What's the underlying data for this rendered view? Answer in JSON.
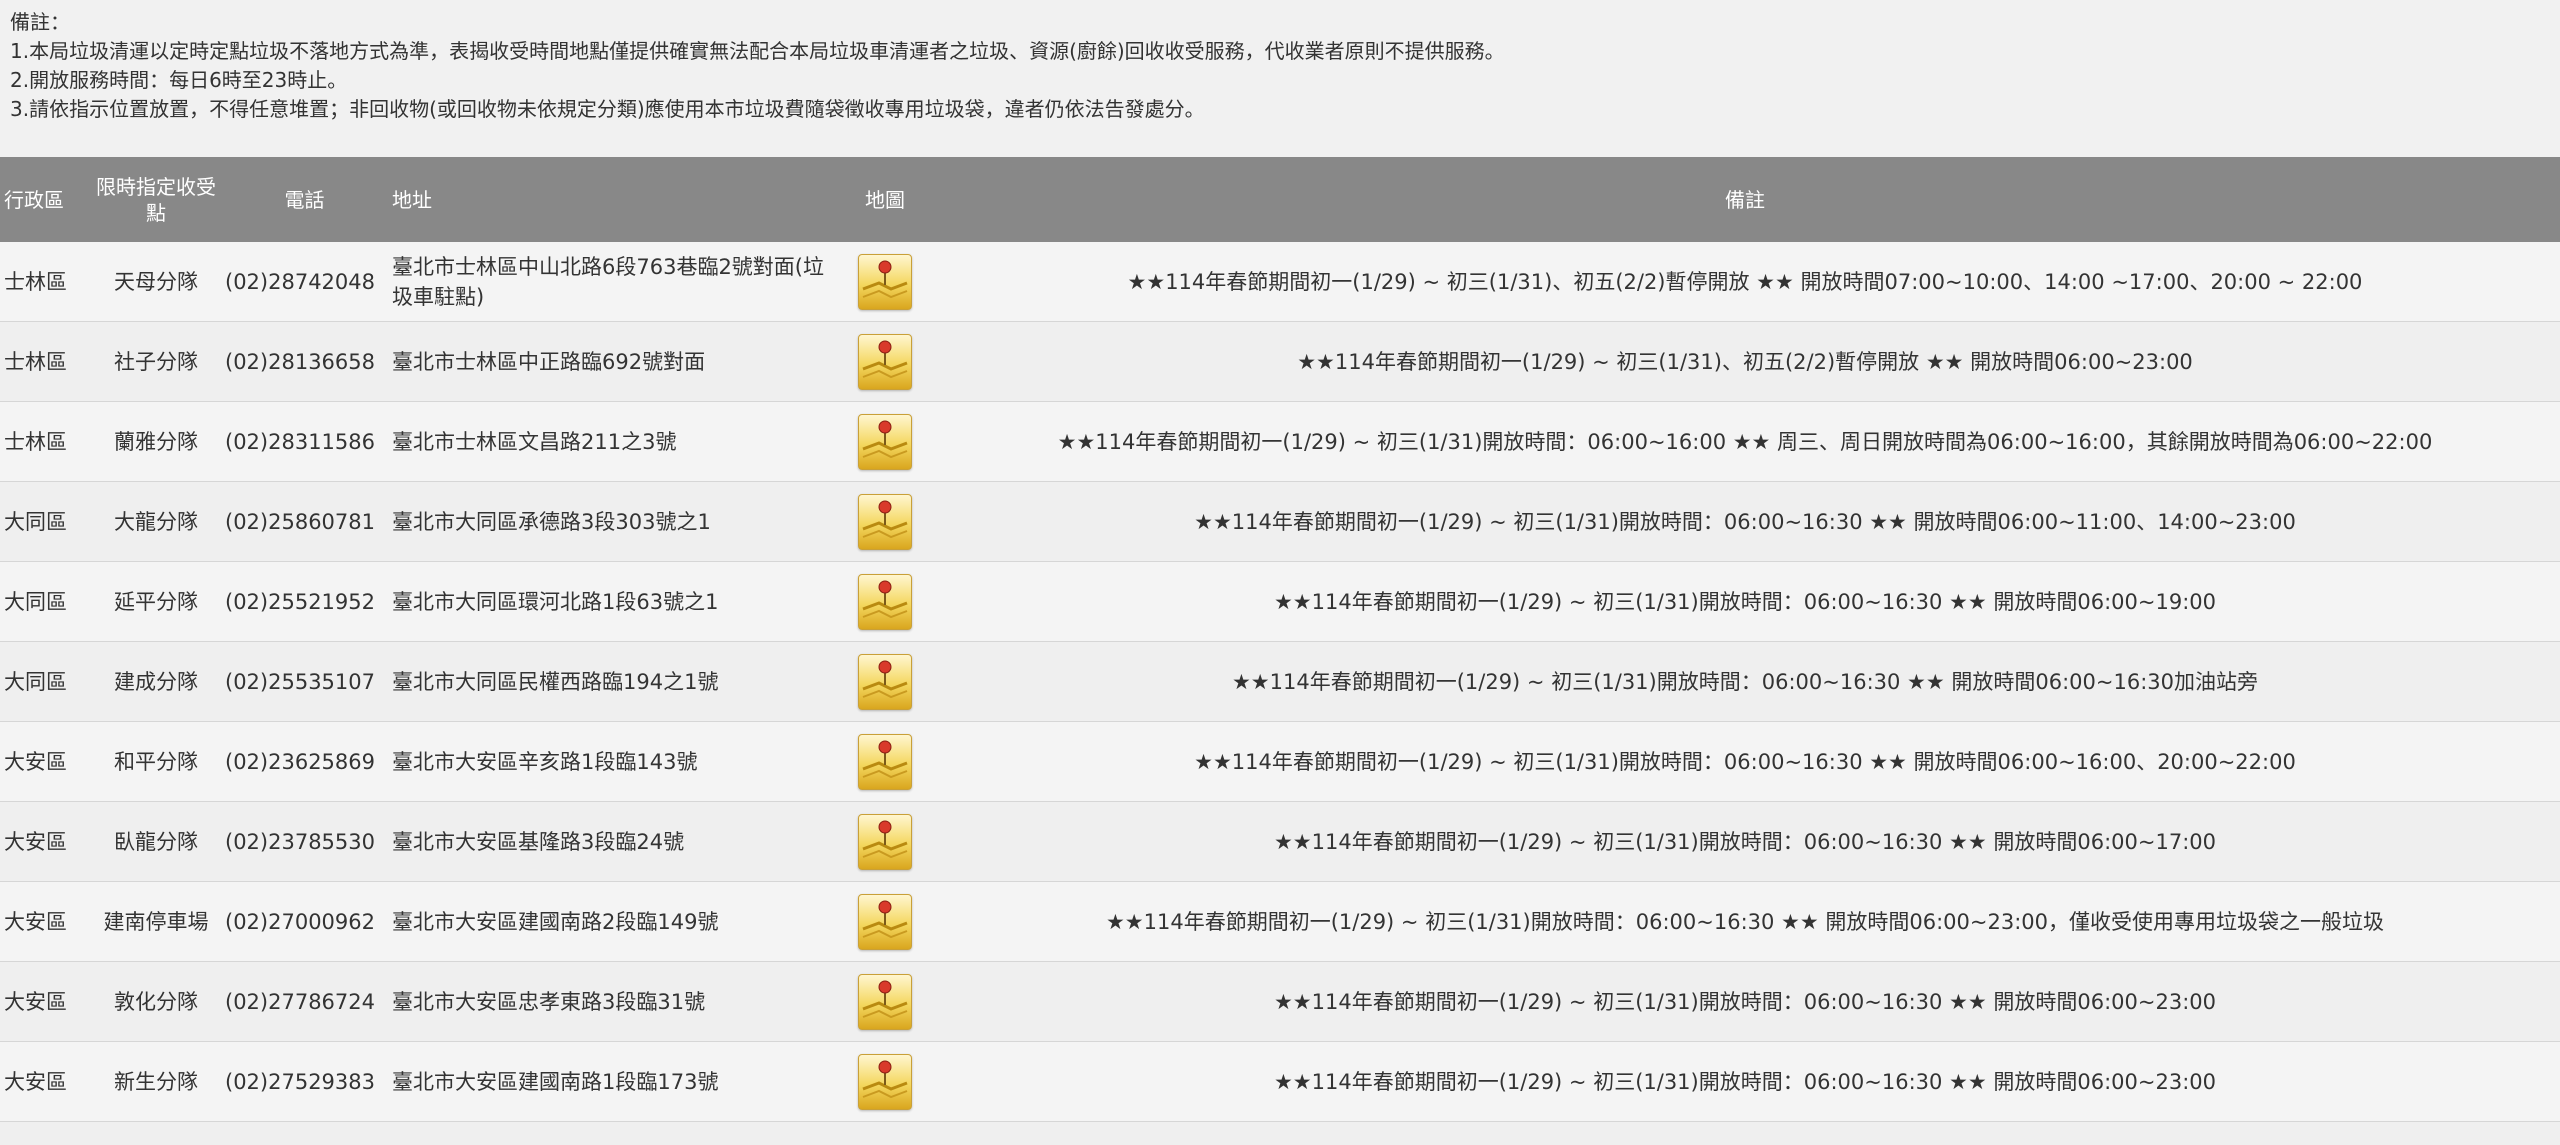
{
  "notes": {
    "heading": "備註：",
    "lines": [
      "1.本局垃圾清運以定時定點垃圾不落地方式為準，表揭收受時間地點僅提供確實無法配合本局垃圾車清運者之垃圾、資源(廚餘)回收收受服務，代收業者原則不提供服務。",
      "2.開放服務時間：每日6時至23時止。",
      "3.請依指示位置放置，不得任意堆置；非回收物(或回收物未依規定分類)應使用本市垃圾費隨袋徵收專用垃圾袋，違者仍依法告發處分。"
    ]
  },
  "table": {
    "headers": {
      "district": "行政區",
      "site": "限時指定收受點",
      "phone": "電話",
      "address": "地址",
      "map": "地圖",
      "remark": "備註"
    },
    "rows": [
      {
        "district": "士林區",
        "site": "天母分隊",
        "phone": "(02)28742048",
        "address": "臺北市士林區中山北路6段763巷臨2號對面(垃圾車駐點)",
        "remark": "★★114年春節期間初一(1/29) ~ 初三(1/31)、初五(2/2)暫停開放 ★★ 開放時間07:00~10:00、14:00 ~17:00、20:00 ~ 22:00"
      },
      {
        "district": "士林區",
        "site": "社子分隊",
        "phone": "(02)28136658",
        "address": "臺北市士林區中正路臨692號對面",
        "remark": "★★114年春節期間初一(1/29) ~ 初三(1/31)、初五(2/2)暫停開放 ★★ 開放時間06:00~23:00"
      },
      {
        "district": "士林區",
        "site": "蘭雅分隊",
        "phone": "(02)28311586",
        "address": "臺北市士林區文昌路211之3號",
        "remark": "★★114年春節期間初一(1/29) ~ 初三(1/31)開放時間：06:00~16:00 ★★ 周三、周日開放時間為06:00~16:00，其餘開放時間為06:00~22:00"
      },
      {
        "district": "大同區",
        "site": "大龍分隊",
        "phone": "(02)25860781",
        "address": "臺北市大同區承德路3段303號之1",
        "remark": "★★114年春節期間初一(1/29) ~ 初三(1/31)開放時間：06:00~16:30 ★★ 開放時間06:00~11:00、14:00~23:00"
      },
      {
        "district": "大同區",
        "site": "延平分隊",
        "phone": "(02)25521952",
        "address": "臺北市大同區環河北路1段63號之1",
        "remark": "★★114年春節期間初一(1/29) ~ 初三(1/31)開放時間：06:00~16:30 ★★ 開放時間06:00~19:00"
      },
      {
        "district": "大同區",
        "site": "建成分隊",
        "phone": "(02)25535107",
        "address": "臺北市大同區民權西路臨194之1號",
        "remark": "★★114年春節期間初一(1/29) ~ 初三(1/31)開放時間：06:00~16:30 ★★ 開放時間06:00~16:30加油站旁"
      },
      {
        "district": "大安區",
        "site": "和平分隊",
        "phone": "(02)23625869",
        "address": "臺北市大安區辛亥路1段臨143號",
        "remark": "★★114年春節期間初一(1/29) ~ 初三(1/31)開放時間：06:00~16:30 ★★ 開放時間06:00~16:00、20:00~22:00"
      },
      {
        "district": "大安區",
        "site": "臥龍分隊",
        "phone": "(02)23785530",
        "address": "臺北市大安區基隆路3段臨24號",
        "remark": "★★114年春節期間初一(1/29) ~ 初三(1/31)開放時間：06:00~16:30 ★★ 開放時間06:00~17:00"
      },
      {
        "district": "大安區",
        "site": "建南停車場",
        "phone": "(02)27000962",
        "address": "臺北市大安區建國南路2段臨149號",
        "remark": "★★114年春節期間初一(1/29) ~ 初三(1/31)開放時間：06:00~16:30 ★★ 開放時間06:00~23:00，僅收受使用專用垃圾袋之一般垃圾"
      },
      {
        "district": "大安區",
        "site": "敦化分隊",
        "phone": "(02)27786724",
        "address": "臺北市大安區忠孝東路3段臨31號",
        "remark": "★★114年春節期間初一(1/29) ~ 初三(1/31)開放時間：06:00~16:30 ★★ 開放時間06:00~23:00"
      },
      {
        "district": "大安區",
        "site": "新生分隊",
        "phone": "(02)27529383",
        "address": "臺北市大安區建國南路1段臨173號",
        "remark": "★★114年春節期間初一(1/29) ~ 初三(1/31)開放時間：06:00~16:30 ★★ 開放時間06:00~23:00"
      }
    ]
  },
  "icons": {
    "map": "map-icon"
  },
  "colors": {
    "header_bg": "#888888",
    "header_text": "#ffffff",
    "page_bg": "#f1f1f1",
    "map_icon": "#f4d75e"
  }
}
